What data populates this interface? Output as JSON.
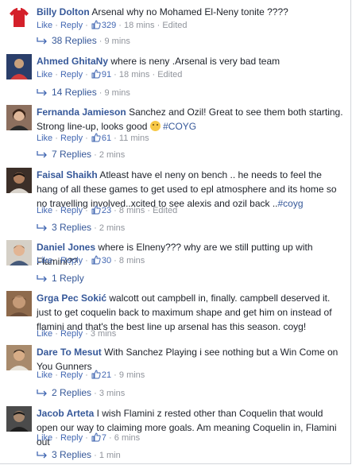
{
  "ui": {
    "like": "Like",
    "reply": "Reply",
    "dot": "·"
  },
  "comments": [
    {
      "author": "Billy Dolton",
      "text": "Arsenal why no Mohamed El-Neny tonite ????",
      "likes": "329",
      "time": "18 mins",
      "edited": "Edited",
      "replies": "38 Replies",
      "reply_time": "9 mins"
    },
    {
      "author": "Ahmed GhitaNy",
      "text": "where is neny .Arsenal is very bad team",
      "likes": "91",
      "time": "18 mins",
      "edited": "Edited",
      "replies": "14 Replies",
      "reply_time": "9 mins"
    },
    {
      "author": "Fernanda Jamieson",
      "text": "Sanchez and Ozil! Great to see them both starting. Strong line-up, looks good",
      "hashtag": "#COYG",
      "likes": "61",
      "time": "11 mins",
      "replies": "7 Replies",
      "reply_time": "2 mins"
    },
    {
      "author": "Faisal Shaikh",
      "text": "Atleast have el neny on bench .. he needs to feel the hang of all these games to get used to epl atmosphere and its home so no travelling involved..xcited to see alexis and ozil back ..",
      "hashtag": "#coyg",
      "likes": "23",
      "time": "8 mins",
      "edited": "Edited",
      "replies": "3 Replies",
      "reply_time": "2 mins"
    },
    {
      "author": "Daniel Jones",
      "text": "where is Elneny??? why are we still putting up with Flamini??",
      "likes": "30",
      "time": "8 mins",
      "replies": "1 Reply"
    },
    {
      "author": "Grga Pec Sokić",
      "text": "walcott out campbell in, finally. campbell deserved it. just to get coquelin back to maximum shape and get him on instead of flamini and that's the best line up arsenal has this season. coyg!",
      "time": "3 mins"
    },
    {
      "author": "Dare To Mesut",
      "text": "With Sanchez Playing i see nothing but a Win Come on You Gunners",
      "likes": "21",
      "time": "9 mins",
      "replies": "2 Replies",
      "reply_time": "3 mins"
    },
    {
      "author": "Jacob Arteta",
      "text": "I wish Flamini z rested other than Coquelin that would open our way to claiming more goals. Am meaning Coquelin in, Flamini out",
      "likes": "7",
      "time": "6 mins",
      "replies": "3 Replies",
      "reply_time": "1 min"
    }
  ],
  "colors": {
    "link": "#365899",
    "meta": "#90949c",
    "action": "#4267b2"
  }
}
